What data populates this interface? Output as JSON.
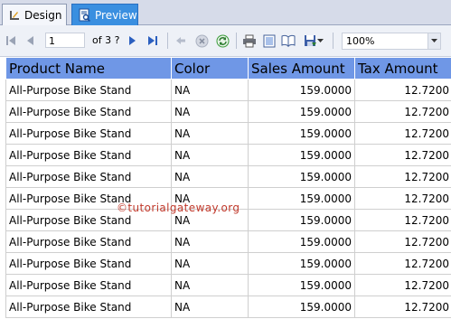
{
  "tabs": {
    "design_label": "Design",
    "preview_label": "Preview"
  },
  "toolbar": {
    "page_value": "1",
    "page_of_label": "of 3 ?",
    "zoom_value": "100%"
  },
  "report": {
    "columns": [
      "Product Name",
      "Color",
      "Sales Amount",
      "Tax Amount"
    ],
    "rows": [
      [
        "All-Purpose Bike Stand",
        "NA",
        "159.0000",
        "12.7200"
      ],
      [
        "All-Purpose Bike Stand",
        "NA",
        "159.0000",
        "12.7200"
      ],
      [
        "All-Purpose Bike Stand",
        "NA",
        "159.0000",
        "12.7200"
      ],
      [
        "All-Purpose Bike Stand",
        "NA",
        "159.0000",
        "12.7200"
      ],
      [
        "All-Purpose Bike Stand",
        "NA",
        "159.0000",
        "12.7200"
      ],
      [
        "All-Purpose Bike Stand",
        "NA",
        "159.0000",
        "12.7200"
      ],
      [
        "All-Purpose Bike Stand",
        "NA",
        "159.0000",
        "12.7200"
      ],
      [
        "All-Purpose Bike Stand",
        "NA",
        "159.0000",
        "12.7200"
      ],
      [
        "All-Purpose Bike Stand",
        "NA",
        "159.0000",
        "12.7200"
      ],
      [
        "All-Purpose Bike Stand",
        "NA",
        "159.0000",
        "12.7200"
      ],
      [
        "All-Purpose Bike Stand",
        "NA",
        "159.0000",
        "12.7200"
      ]
    ]
  },
  "watermark": {
    "text": "©tutorialgateway.org"
  },
  "colors": {
    "header_bg": "#6f97e6",
    "active_tab": "#3a8fe0",
    "watermark": "#c0392b"
  }
}
